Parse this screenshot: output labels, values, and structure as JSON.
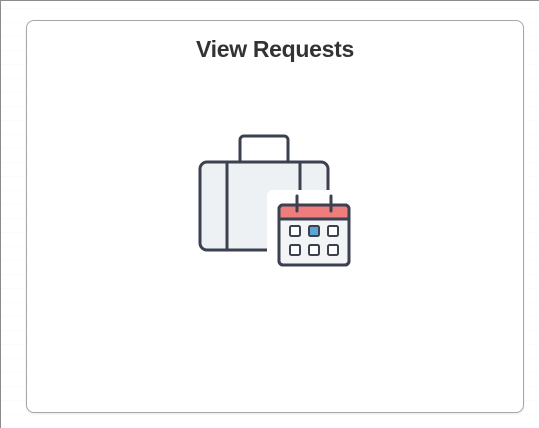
{
  "tile": {
    "title": "View Requests",
    "icon": "briefcase-calendar-icon"
  },
  "colors": {
    "title_text": "#333333",
    "tile_border": "#a6a6a6",
    "icon_stroke": "#3b4150",
    "briefcase_fill": "#eef1f4",
    "calendar_header": "#ef7d7d",
    "calendar_highlight": "#5ba4d6"
  }
}
